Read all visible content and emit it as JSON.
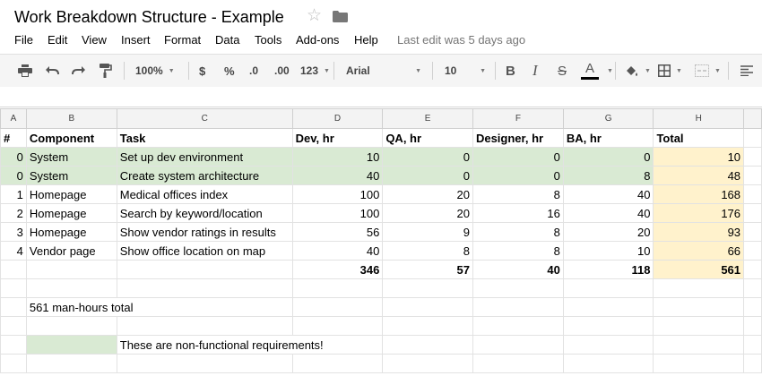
{
  "doc": {
    "title": "Work Breakdown Structure - Example"
  },
  "menu": {
    "items": [
      "File",
      "Edit",
      "View",
      "Insert",
      "Format",
      "Data",
      "Tools",
      "Add-ons",
      "Help"
    ],
    "last_edit": "Last edit was 5 days ago"
  },
  "toolbar": {
    "zoom": "100%",
    "currency": "$",
    "percent": "%",
    "decrease_decimals": ".0",
    "increase_decimals": ".00",
    "more_formats": "123",
    "font": "Arial",
    "font_size": "10",
    "bold": "B",
    "italic": "I",
    "strike": "S",
    "text_color": "A"
  },
  "columns": [
    "A",
    "B",
    "C",
    "D",
    "E",
    "F",
    "G",
    "H"
  ],
  "header_row": [
    "#",
    "Component",
    "Task",
    "Dev, hr",
    "QA, hr",
    "Designer, hr",
    "BA, hr",
    "Total"
  ],
  "rows": [
    [
      "0",
      "System",
      "Set up dev environment",
      "10",
      "0",
      "0",
      "0",
      "10"
    ],
    [
      "0",
      "System",
      "Create system architecture",
      "40",
      "0",
      "0",
      "8",
      "48"
    ],
    [
      "1",
      "Homepage",
      "Medical offices index",
      "100",
      "20",
      "8",
      "40",
      "168"
    ],
    [
      "2",
      "Homepage",
      "Search by keyword/location",
      "100",
      "20",
      "16",
      "40",
      "176"
    ],
    [
      "3",
      "Homepage",
      "Show vendor ratings in results",
      "56",
      "9",
      "8",
      "20",
      "93"
    ],
    [
      "4",
      "Vendor page",
      "Show office location on map",
      "40",
      "8",
      "8",
      "10",
      "66"
    ]
  ],
  "totals": [
    "",
    "",
    "",
    "346",
    "57",
    "40",
    "118",
    "561"
  ],
  "note_total": "561 man-hours total",
  "legend_text": "These are non-functional requirements!",
  "colors": {
    "nonfunctional_fill": "#d9ead3",
    "total_fill": "#fff2cc",
    "header_bg": "#f3f3f3"
  }
}
